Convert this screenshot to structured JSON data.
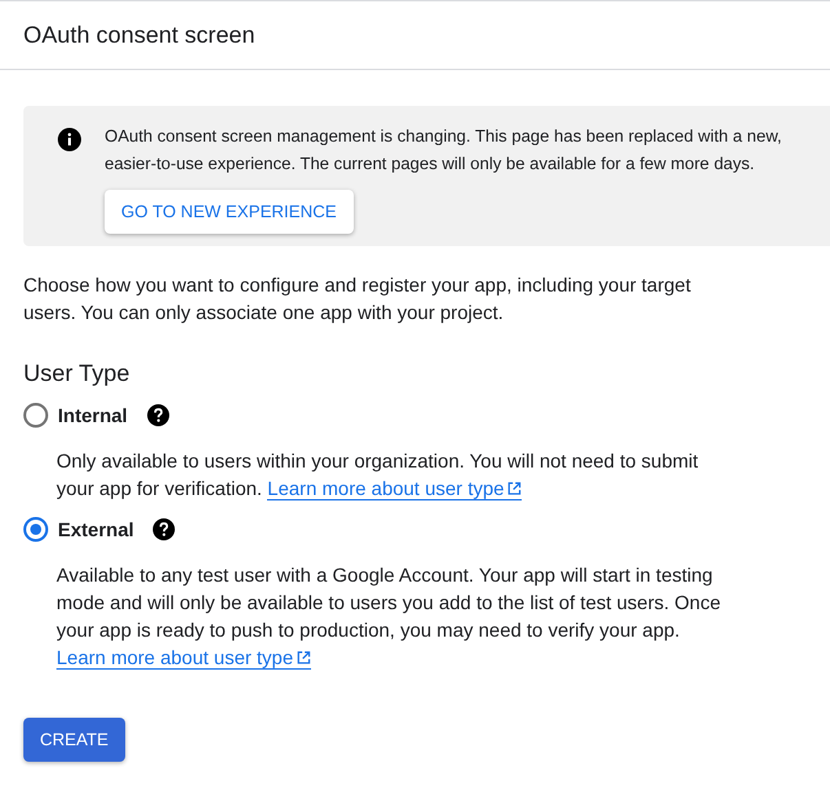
{
  "header": {
    "title": "OAuth consent screen"
  },
  "notice": {
    "message": "OAuth consent screen management is changing. This page has been replaced with a new, easier-to-use experience. The current pages will only be available for a few more days.",
    "button": "GO TO NEW EXPERIENCE"
  },
  "intro": "Choose how you want to configure and register your app, including your target users. You can only associate one app with your project.",
  "user_type": {
    "heading": "User Type",
    "options": [
      {
        "label": "Internal",
        "selected": false,
        "description": "Only available to users within your organization. You will not need to submit your app for verification.",
        "link": "Learn more about user type"
      },
      {
        "label": "External",
        "selected": true,
        "description": "Available to any test user with a Google Account. Your app will start in testing mode and will only be available to users you add to the list of test users. Once your app is ready to push to production, you may need to verify your app.",
        "link": "Learn more about user type"
      }
    ]
  },
  "create_button": "CREATE"
}
